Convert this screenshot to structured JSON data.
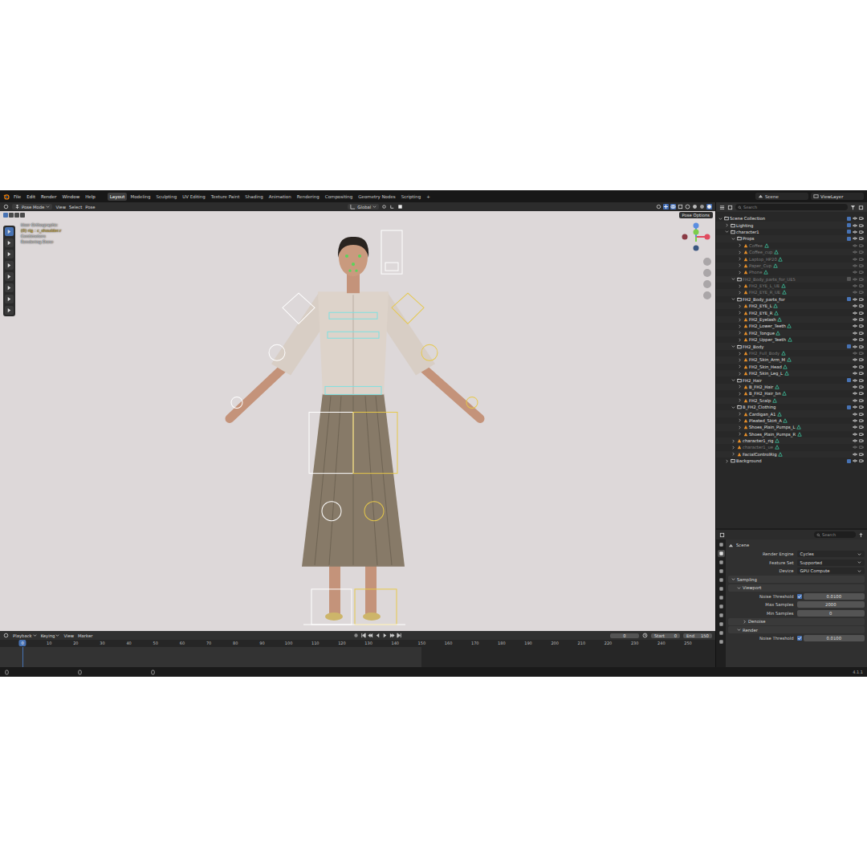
{
  "window": {
    "title": "Blender"
  },
  "menu": [
    "File",
    "Edit",
    "Render",
    "Window",
    "Help"
  ],
  "workspaces": [
    {
      "label": "Layout",
      "selected": true
    },
    {
      "label": "Modeling",
      "selected": false
    },
    {
      "label": "Sculpting",
      "selected": false
    },
    {
      "label": "UV Editing",
      "selected": false
    },
    {
      "label": "Texture Paint",
      "selected": false
    },
    {
      "label": "Shading",
      "selected": false
    },
    {
      "label": "Animation",
      "selected": false
    },
    {
      "label": "Rendering",
      "selected": false
    },
    {
      "label": "Compositing",
      "selected": false
    },
    {
      "label": "Geometry Nodes",
      "selected": false
    },
    {
      "label": "Scripting",
      "selected": false
    }
  ],
  "add_workspace": "+",
  "scene": "Scene",
  "view_layer": "ViewLayer",
  "viewport": {
    "mode": "Pose Mode",
    "menus": [
      "View",
      "Select",
      "Pose"
    ],
    "orientation": "Global",
    "pose_options": "Pose Options",
    "overlay": [
      {
        "text": "User Orthographic",
        "color": "#e8e8e8"
      },
      {
        "text": "(0) rig : c_shoulder.r",
        "color": "#e0c040"
      },
      {
        "text": "Centimeters",
        "color": "#e8e8e8"
      },
      {
        "text": "Rendering Done",
        "color": "#e8e8e8"
      }
    ],
    "tools": [
      {
        "selected": true
      },
      {
        "selected": false
      },
      {
        "selected": false
      },
      {
        "selected": false
      },
      {
        "selected": false
      },
      {
        "selected": false
      },
      {
        "selected": false
      },
      {
        "selected": false
      }
    ]
  },
  "outliner": {
    "search": "Search",
    "rows": [
      {
        "label": "Scene Collection",
        "kind": "collection",
        "depth": 0,
        "expanded": true,
        "disabled": false,
        "checked": true
      },
      {
        "label": "Lighting",
        "kind": "collection",
        "depth": 1,
        "expanded": false,
        "disabled": false,
        "checked": true
      },
      {
        "label": "character1",
        "kind": "collection",
        "depth": 1,
        "expanded": true,
        "disabled": false,
        "checked": true
      },
      {
        "label": "Props",
        "kind": "collection",
        "depth": 2,
        "expanded": true,
        "disabled": false,
        "checked": true
      },
      {
        "label": "Coffee",
        "kind": "object",
        "depth": 3,
        "expanded": false,
        "disabled": true,
        "checked": false
      },
      {
        "label": "Coffee_cup",
        "kind": "object",
        "depth": 3,
        "expanded": false,
        "disabled": true,
        "checked": false
      },
      {
        "label": "Laptop_HP20",
        "kind": "object",
        "depth": 3,
        "expanded": false,
        "disabled": true,
        "checked": false
      },
      {
        "label": "Paper_Cup",
        "kind": "object",
        "depth": 3,
        "expanded": false,
        "disabled": true,
        "checked": false
      },
      {
        "label": "Phone",
        "kind": "object",
        "depth": 3,
        "expanded": false,
        "disabled": true,
        "checked": false
      },
      {
        "label": "FH2_Body_parts_for_UE5",
        "kind": "collection",
        "depth": 2,
        "expanded": true,
        "disabled": true,
        "checked": false
      },
      {
        "label": "FH2_EYE_L_UE",
        "kind": "object",
        "depth": 3,
        "expanded": false,
        "disabled": true,
        "checked": false
      },
      {
        "label": "FH2_EYE_R_UE",
        "kind": "object",
        "depth": 3,
        "expanded": false,
        "disabled": true,
        "checked": false
      },
      {
        "label": "FH2_Body_parts_for",
        "kind": "collection",
        "depth": 2,
        "expanded": true,
        "disabled": false,
        "checked": true
      },
      {
        "label": "FH2_EYE_L",
        "kind": "object",
        "depth": 3,
        "expanded": false,
        "disabled": false,
        "checked": false
      },
      {
        "label": "FH2_EYE_R",
        "kind": "object",
        "depth": 3,
        "expanded": false,
        "disabled": false,
        "checked": false
      },
      {
        "label": "FH2_Eyelash",
        "kind": "object",
        "depth": 3,
        "expanded": false,
        "disabled": false,
        "checked": false
      },
      {
        "label": "FH2_Lower_Teeth",
        "kind": "object",
        "depth": 3,
        "expanded": false,
        "disabled": false,
        "checked": false
      },
      {
        "label": "FH2_Tongue",
        "kind": "object",
        "depth": 3,
        "expanded": false,
        "disabled": false,
        "checked": false
      },
      {
        "label": "FH2_Upper_Teeth",
        "kind": "object",
        "depth": 3,
        "expanded": false,
        "disabled": false,
        "checked": false
      },
      {
        "label": "FH2_Body",
        "kind": "collection",
        "depth": 2,
        "expanded": true,
        "disabled": false,
        "checked": true
      },
      {
        "label": "FH2_Full_Body",
        "kind": "object",
        "depth": 3,
        "expanded": false,
        "disabled": true,
        "checked": false
      },
      {
        "label": "FH2_Skin_Arm_M",
        "kind": "object",
        "depth": 3,
        "expanded": false,
        "disabled": false,
        "checked": false
      },
      {
        "label": "FH2_Skin_Head",
        "kind": "object",
        "depth": 3,
        "expanded": false,
        "disabled": false,
        "checked": false
      },
      {
        "label": "FH2_Skin_Leg_L",
        "kind": "object",
        "depth": 3,
        "expanded": false,
        "disabled": false,
        "checked": false
      },
      {
        "label": "FH2_Hair",
        "kind": "collection",
        "depth": 2,
        "expanded": true,
        "disabled": false,
        "checked": true
      },
      {
        "label": "B_FH2_Hair",
        "kind": "object",
        "depth": 3,
        "expanded": false,
        "disabled": false,
        "checked": false
      },
      {
        "label": "B_FH2_Hair_bn",
        "kind": "object",
        "depth": 3,
        "expanded": false,
        "disabled": false,
        "checked": false
      },
      {
        "label": "FH2_Scalp",
        "kind": "object",
        "depth": 3,
        "expanded": false,
        "disabled": false,
        "checked": false
      },
      {
        "label": "B_FH2_Clothing",
        "kind": "collection",
        "depth": 2,
        "expanded": true,
        "disabled": false,
        "checked": true
      },
      {
        "label": "Cardigan_A1",
        "kind": "object",
        "depth": 3,
        "expanded": false,
        "disabled": false,
        "checked": false
      },
      {
        "label": "Pleated_Skirt_A",
        "kind": "object",
        "depth": 3,
        "expanded": false,
        "disabled": false,
        "checked": false
      },
      {
        "label": "Shoes_Plain_Pumps_L",
        "kind": "object",
        "depth": 3,
        "expanded": false,
        "disabled": false,
        "checked": false
      },
      {
        "label": "Shoes_Plain_Pumps_R",
        "kind": "object",
        "depth": 3,
        "expanded": false,
        "disabled": false,
        "checked": false
      },
      {
        "label": "character1_rig",
        "kind": "object",
        "depth": 2,
        "expanded": false,
        "disabled": false,
        "checked": false
      },
      {
        "label": "character1_ue",
        "kind": "object",
        "depth": 2,
        "expanded": false,
        "disabled": true,
        "checked": false
      },
      {
        "label": "FacialControlRig",
        "kind": "object",
        "depth": 2,
        "expanded": false,
        "disabled": false,
        "checked": false
      },
      {
        "label": "Background",
        "kind": "collection",
        "depth": 1,
        "expanded": false,
        "disabled": false,
        "checked": true
      }
    ]
  },
  "properties": {
    "search": "Search",
    "context": "Scene",
    "tabs": [
      {
        "selected": false
      },
      {
        "selected": true
      },
      {
        "selected": false
      },
      {
        "selected": false
      },
      {
        "selected": false
      },
      {
        "selected": false
      },
      {
        "selected": false
      },
      {
        "selected": false
      },
      {
        "selected": false
      },
      {
        "selected": false
      },
      {
        "selected": false
      },
      {
        "selected": false
      }
    ],
    "rows": [
      {
        "kind": "dropdown",
        "label": "Render Engine",
        "value": "Cycles"
      },
      {
        "kind": "dropdown",
        "label": "Feature Set",
        "value": "Supported"
      },
      {
        "kind": "dropdown",
        "label": "Device",
        "value": "GPU Compute"
      },
      {
        "kind": "panel",
        "label": "Sampling",
        "expanded": true,
        "depth": 0
      },
      {
        "kind": "panel",
        "label": "Viewport",
        "expanded": true,
        "depth": 1
      },
      {
        "kind": "check-number",
        "label": "Noise Threshold",
        "value": "0.0100",
        "checked": true
      },
      {
        "kind": "number",
        "label": "Max Samples",
        "value": "2000"
      },
      {
        "kind": "number",
        "label": "Min Samples",
        "value": "0"
      },
      {
        "kind": "panel",
        "label": "Denoise",
        "expanded": false,
        "depth": 2
      },
      {
        "kind": "panel",
        "label": "Render",
        "expanded": true,
        "depth": 1
      },
      {
        "kind": "check-number",
        "label": "Noise Threshold",
        "value": "0.0100",
        "checked": true
      }
    ]
  },
  "timeline": {
    "menus": [
      {
        "label": "Playback",
        "dropdown": true
      },
      {
        "label": "Keying",
        "dropdown": true
      },
      {
        "label": "View",
        "dropdown": false
      },
      {
        "label": "Marker",
        "dropdown": false
      }
    ],
    "current_frame": "0",
    "start": {
      "label": "Start",
      "value": "0"
    },
    "end": {
      "label": "End",
      "value": "150"
    },
    "ticks": [
      "0",
      "10",
      "20",
      "30",
      "40",
      "50",
      "60",
      "70",
      "80",
      "90",
      "100",
      "110",
      "120",
      "130",
      "140",
      "150",
      "160",
      "170",
      "180",
      "190",
      "200",
      "210",
      "220",
      "230",
      "240",
      "250"
    ]
  },
  "status_bar": {
    "version": "4.1.1"
  }
}
